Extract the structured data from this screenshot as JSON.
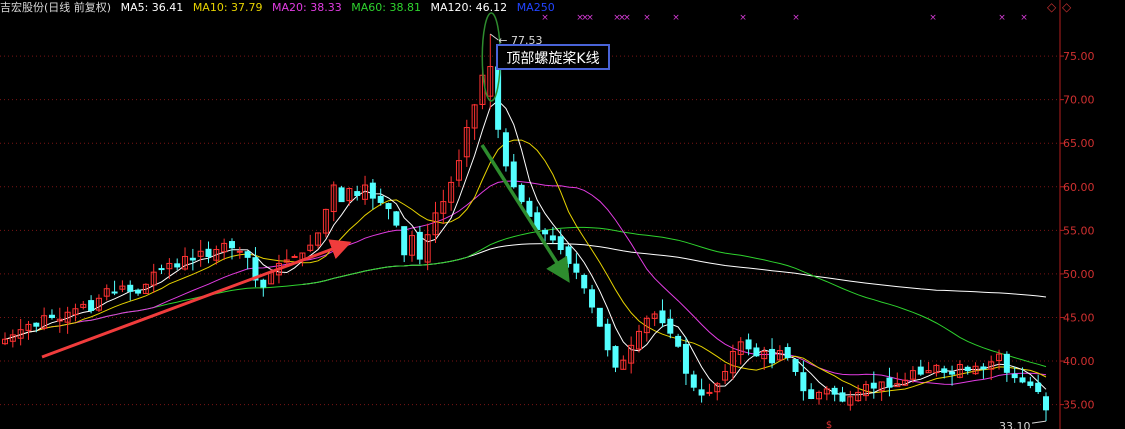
{
  "header": {
    "stock": "吉宏股份(日线 前复权)",
    "indicators": [
      {
        "label": "MA5: 36.41",
        "color": "#ffffff"
      },
      {
        "label": "MA10: 37.79",
        "color": "#e6d200"
      },
      {
        "label": "MA20: 38.33",
        "color": "#e23ce2"
      },
      {
        "label": "MA60: 38.81",
        "color": "#2ed22e"
      },
      {
        "label": "MA120: 46.12",
        "color": "#ffffff"
      },
      {
        "label": "MA250",
        "color": "#2244ff"
      }
    ]
  },
  "annotation": {
    "text": "顶部螺旋桨K线"
  },
  "nav_icons": [
    "diamond-left-icon",
    "diamond-right-icon"
  ],
  "chart_data": {
    "type": "candlestick",
    "y_axis": {
      "ticks": [
        "75.00",
        "70.00",
        "65.00",
        "60.00",
        "55.00",
        "50.00",
        "45.00",
        "40.00",
        "35.00"
      ],
      "ylim": [
        32.2,
        79.6
      ],
      "side": "right"
    },
    "high_label": "77.53",
    "low_label": "33.10",
    "high_value": 77.53,
    "low_value": 33.1,
    "colors": {
      "up": "#ff3232",
      "down": "#54ffff",
      "grid": "#7a1414",
      "axis": "#b41e1e",
      "ma5": "#ffffff",
      "ma10": "#e6d200",
      "ma20": "#e23ce2",
      "ma60": "#2ed22e",
      "ma120": "#ffffff",
      "trend_up": "#f03c3c",
      "trend_down": "#2e8c2e"
    },
    "closes": [
      42.5,
      43.0,
      43.6,
      44.2,
      44.0,
      45.2,
      45.0,
      44.8,
      45.6,
      46.0,
      46.5,
      45.8,
      47.2,
      48.3,
      47.9,
      48.6,
      48.0,
      47.8,
      48.8,
      50.2,
      50.6,
      51.2,
      50.8,
      52.0,
      51.6,
      52.6,
      52.0,
      52.8,
      53.5,
      53.0,
      52.6,
      51.9,
      49.3,
      48.5,
      50.2,
      51.2,
      51.6,
      52.0,
      52.4,
      53.3,
      54.7,
      57.4,
      60.2,
      58.3,
      59.8,
      59.0,
      60.2,
      58.7,
      58.2,
      57.5,
      55.6,
      52.2,
      54.4,
      51.7,
      54.5,
      57.0,
      58.3,
      60.5,
      63.0,
      66.8,
      69.4,
      72.8,
      73.8,
      66.6,
      62.4,
      60.0,
      58.3,
      56.6,
      55.1,
      54.6,
      53.9,
      52.8,
      51.2,
      50.2,
      48.4,
      46.2,
      44.0,
      41.3,
      39.3,
      40.1,
      41.8,
      43.4,
      44.9,
      45.4,
      44.4,
      43.2,
      41.7,
      38.6,
      37.0,
      36.1,
      36.4,
      37.4,
      38.8,
      41.1,
      42.2,
      41.4,
      40.6,
      41.1,
      39.8,
      41.2,
      40.4,
      38.8,
      36.6,
      35.7,
      36.4,
      36.8,
      36.2,
      35.4,
      35.9,
      36.4,
      37.3,
      36.9,
      37.6,
      37.0,
      37.4,
      37.8,
      38.9,
      38.5,
      38.9,
      39.5,
      38.7,
      38.5,
      39.6,
      38.9,
      39.4,
      39.1,
      39.9,
      40.8,
      38.7,
      38.1,
      37.6,
      37.2,
      36.5,
      34.4
    ]
  }
}
